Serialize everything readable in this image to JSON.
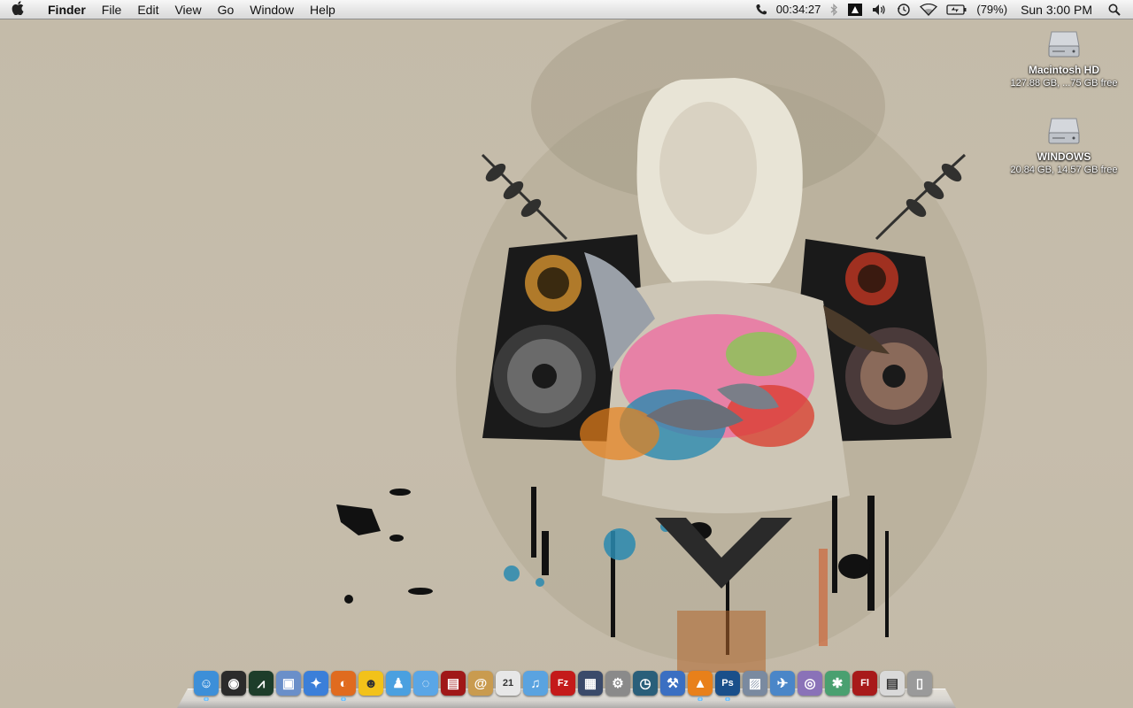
{
  "menubar": {
    "apple_icon": "apple-logo-icon",
    "app_name": "Finder",
    "menus": [
      "File",
      "Edit",
      "View",
      "Go",
      "Window",
      "Help"
    ],
    "status": {
      "call_timer": "00:34:27",
      "battery_percent": "(79%)",
      "clock": "Sun 3:00 PM"
    },
    "icons": [
      "phone-icon",
      "bluetooth-icon",
      "mirror-icon",
      "volume-icon",
      "time-machine-icon",
      "wifi-icon",
      "battery-icon",
      "spotlight-icon"
    ]
  },
  "desktop": {
    "drives": [
      {
        "name": "Macintosh HD",
        "info": "127.88 GB, ...75 GB free",
        "icon": "hard-drive-icon"
      },
      {
        "name": "WINDOWS",
        "info": "20.84 GB, 14.57 GB free",
        "icon": "hard-drive-icon"
      }
    ]
  },
  "dock": {
    "items": [
      {
        "name": "finder",
        "glyph": "☺",
        "bg": "#3d8fd8",
        "running": true
      },
      {
        "name": "dashboard",
        "glyph": "◉",
        "bg": "#2b2b2b",
        "running": false
      },
      {
        "name": "activity-monitor",
        "glyph": "⩘",
        "bg": "#1d3d2a",
        "running": false
      },
      {
        "name": "preview",
        "glyph": "▣",
        "bg": "#6a8fc9",
        "running": false
      },
      {
        "name": "safari",
        "glyph": "✦",
        "bg": "#3b7fd9",
        "running": false
      },
      {
        "name": "firefox",
        "glyph": "◐",
        "bg": "#e06b1f",
        "running": true
      },
      {
        "name": "adium",
        "glyph": "☻",
        "bg": "#f2c21a",
        "running": false
      },
      {
        "name": "messenger",
        "glyph": "♟",
        "bg": "#4aa0e0",
        "running": false
      },
      {
        "name": "ichat",
        "glyph": "◌",
        "bg": "#5aa6e6",
        "running": false
      },
      {
        "name": "photo-booth",
        "glyph": "▤",
        "bg": "#a01818",
        "running": false
      },
      {
        "name": "address-book",
        "glyph": "@",
        "bg": "#c99b4f",
        "running": false
      },
      {
        "name": "ical",
        "glyph": "21",
        "bg": "#e7e7e7",
        "running": false
      },
      {
        "name": "itunes",
        "glyph": "♫",
        "bg": "#5aa3e0",
        "running": false
      },
      {
        "name": "filezilla",
        "glyph": "Fz",
        "bg": "#c41a1a",
        "running": false
      },
      {
        "name": "spaces",
        "glyph": "▦",
        "bg": "#3a4a6a",
        "running": false
      },
      {
        "name": "system-preferences",
        "glyph": "⚙",
        "bg": "#8a8a8a",
        "running": false
      },
      {
        "name": "time-machine",
        "glyph": "◷",
        "bg": "#2a5f7a",
        "running": false
      },
      {
        "name": "xcode",
        "glyph": "⚒",
        "bg": "#3a6fc2",
        "running": false
      },
      {
        "name": "vlc",
        "glyph": "▲",
        "bg": "#e8801a",
        "running": true
      },
      {
        "name": "photoshop",
        "glyph": "Ps",
        "bg": "#1a4f8a",
        "running": true
      },
      {
        "name": "iphoto",
        "glyph": "▨",
        "bg": "#7a8aa0",
        "running": false
      },
      {
        "name": "transmit",
        "glyph": "✈",
        "bg": "#4a86c8",
        "running": false
      },
      {
        "name": "itunes-helper",
        "glyph": "◎",
        "bg": "#8a72b8",
        "running": false
      },
      {
        "name": "bittorrent",
        "glyph": "✱",
        "bg": "#4aa070",
        "running": false
      },
      {
        "name": "flash",
        "glyph": "Fl",
        "bg": "#a81a1a",
        "running": false
      },
      {
        "name": "documents-stack",
        "glyph": "▤",
        "bg": "#d9d9d9",
        "running": false
      },
      {
        "name": "trash",
        "glyph": "▯",
        "bg": "#9a9a9a",
        "running": false
      }
    ]
  },
  "colors": {
    "wallpaper": "#c5bcab",
    "menubar": "#e7e7e7"
  }
}
